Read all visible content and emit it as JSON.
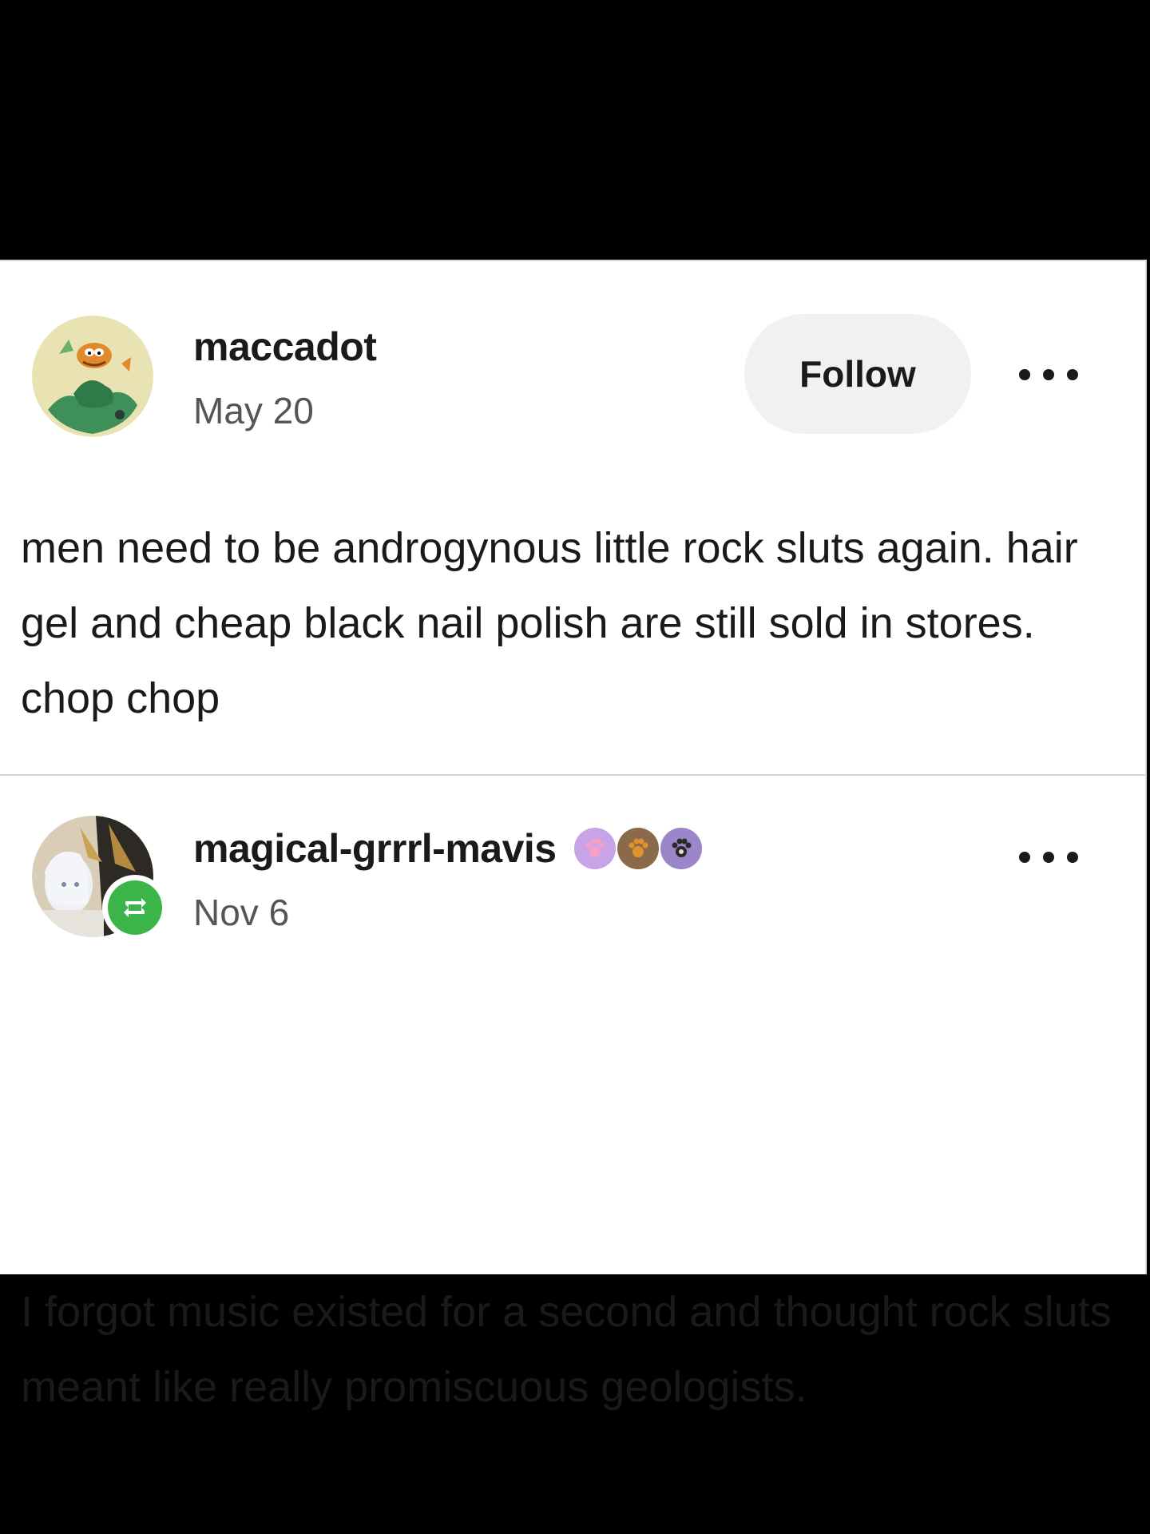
{
  "posts": [
    {
      "username": "maccadot",
      "date": "May 20",
      "follow_label": "Follow",
      "body": "men need to be androgynous little rock sluts again. hair gel and cheap black nail polish are still sold in stores. chop chop"
    },
    {
      "username": "magical-grrrl-mavis",
      "date": "Nov 6",
      "body": "I forgot music existed for a second and thought rock sluts meant like really promiscuous geologists.",
      "badges": [
        "pink-paw-badge-icon",
        "brown-paw-badge-icon",
        "gray-paw-badge-icon"
      ]
    }
  ],
  "colors": {
    "reblog_green": "#3bb54a",
    "follow_bg": "#f1f1f3",
    "text": "#1a1a1a",
    "muted": "#555555"
  }
}
